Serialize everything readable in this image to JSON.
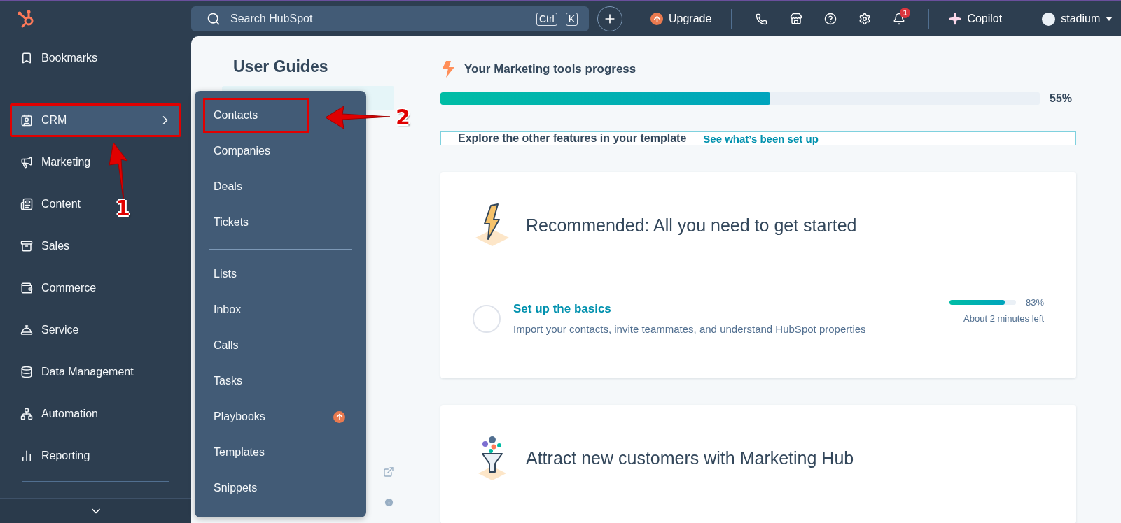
{
  "topbar": {
    "search": {
      "placeholder": "Search HubSpot",
      "shortcut": [
        "Ctrl",
        "K"
      ]
    },
    "upgrade": "Upgrade",
    "notifications": "1",
    "copilot": "Copilot",
    "account": "stadium"
  },
  "sidebar": {
    "top": [
      {
        "label": "Bookmarks",
        "selected": false,
        "highlighted": false
      }
    ],
    "items": [
      {
        "label": "CRM",
        "selected": true,
        "highlighted": true
      },
      {
        "label": "Marketing",
        "selected": false,
        "highlighted": false
      },
      {
        "label": "Content",
        "selected": false,
        "highlighted": false
      },
      {
        "label": "Sales",
        "selected": false,
        "highlighted": false
      },
      {
        "label": "Commerce",
        "selected": false,
        "highlighted": false
      },
      {
        "label": "Service",
        "selected": false,
        "highlighted": false
      },
      {
        "label": "Data Management",
        "selected": false,
        "highlighted": false
      },
      {
        "label": "Automation",
        "selected": false,
        "highlighted": false
      },
      {
        "label": "Reporting",
        "selected": false,
        "highlighted": false
      }
    ]
  },
  "crm_menu": {
    "groups": [
      [
        {
          "label": "Contacts",
          "upgrade": false,
          "highlighted": true
        },
        {
          "label": "Companies",
          "upgrade": false,
          "highlighted": false
        },
        {
          "label": "Deals",
          "upgrade": false,
          "highlighted": false
        },
        {
          "label": "Tickets",
          "upgrade": false,
          "highlighted": false
        }
      ],
      [
        {
          "label": "Lists",
          "upgrade": false,
          "highlighted": false
        },
        {
          "label": "Inbox",
          "upgrade": false,
          "highlighted": false
        },
        {
          "label": "Calls",
          "upgrade": false,
          "highlighted": false
        },
        {
          "label": "Tasks",
          "upgrade": false,
          "highlighted": false
        },
        {
          "label": "Playbooks",
          "upgrade": true,
          "highlighted": false
        },
        {
          "label": "Templates",
          "upgrade": false,
          "highlighted": false
        },
        {
          "label": "Snippets",
          "upgrade": false,
          "highlighted": false
        }
      ]
    ]
  },
  "annotations": {
    "crm_step": "1",
    "contacts_step": "2"
  },
  "guides": {
    "title": "User Guides"
  },
  "progress": {
    "title": "Your Marketing tools progress",
    "level": 0.55,
    "reading": "55%"
  },
  "explore": {
    "text": "Explore the other features in your template",
    "link": "See what’s been set up"
  },
  "cards": [
    {
      "title": "Recommended: All you need to get started",
      "tasks": [
        {
          "title": "Set up the basics",
          "description": "Import your contacts, invite teammates, and understand HubSpot properties",
          "done": false,
          "level": 0.83,
          "reading": "83%",
          "time": "About 2 minutes left"
        }
      ]
    },
    {
      "title": "Attract new customers with Marketing Hub"
    }
  ]
}
